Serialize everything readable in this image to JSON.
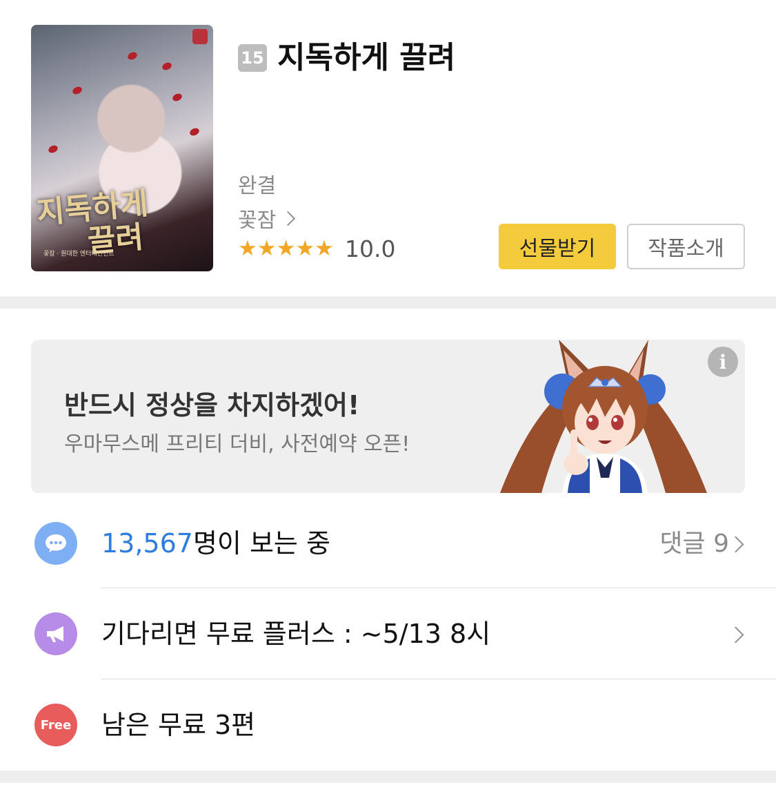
{
  "header": {
    "age_rating": "15",
    "title": "지독하게 끌려",
    "status": "완결",
    "author": "꽃잠",
    "stars": "★★★★★",
    "score": "10.0",
    "gift_button": "선물받기",
    "intro_button": "작품소개",
    "cover": {
      "title_line1": "지독하게",
      "title_line2": "끌려",
      "credits": "꽃잠 · 원대한 엔터테인먼트"
    }
  },
  "banner": {
    "headline": "반드시 정상을 차지하겠어!",
    "subline": "우마무스메 프리티 더비, 사전예약 오픈!",
    "info_icon": "i"
  },
  "viewers": {
    "count": "13,567",
    "suffix": "명이 보는 중",
    "comments_label": "댓글 9"
  },
  "wait_free": {
    "text": "기다리면 무료 플러스 : ~5/13 8시"
  },
  "free_left": {
    "badge": "Free",
    "text": "남은 무료 3편"
  },
  "colors": {
    "accent_yellow": "#f4cb3c",
    "viewers_icon": "#7eaef3",
    "waitfree_icon": "#b78ce8",
    "free_icon": "#e85c5c",
    "count_blue": "#2d7ce0",
    "star": "#f3a623"
  },
  "icons": {
    "viewers": "chat-bubble-icon",
    "wait_free": "megaphone-icon",
    "free": "free-badge-icon",
    "info": "info-icon"
  }
}
